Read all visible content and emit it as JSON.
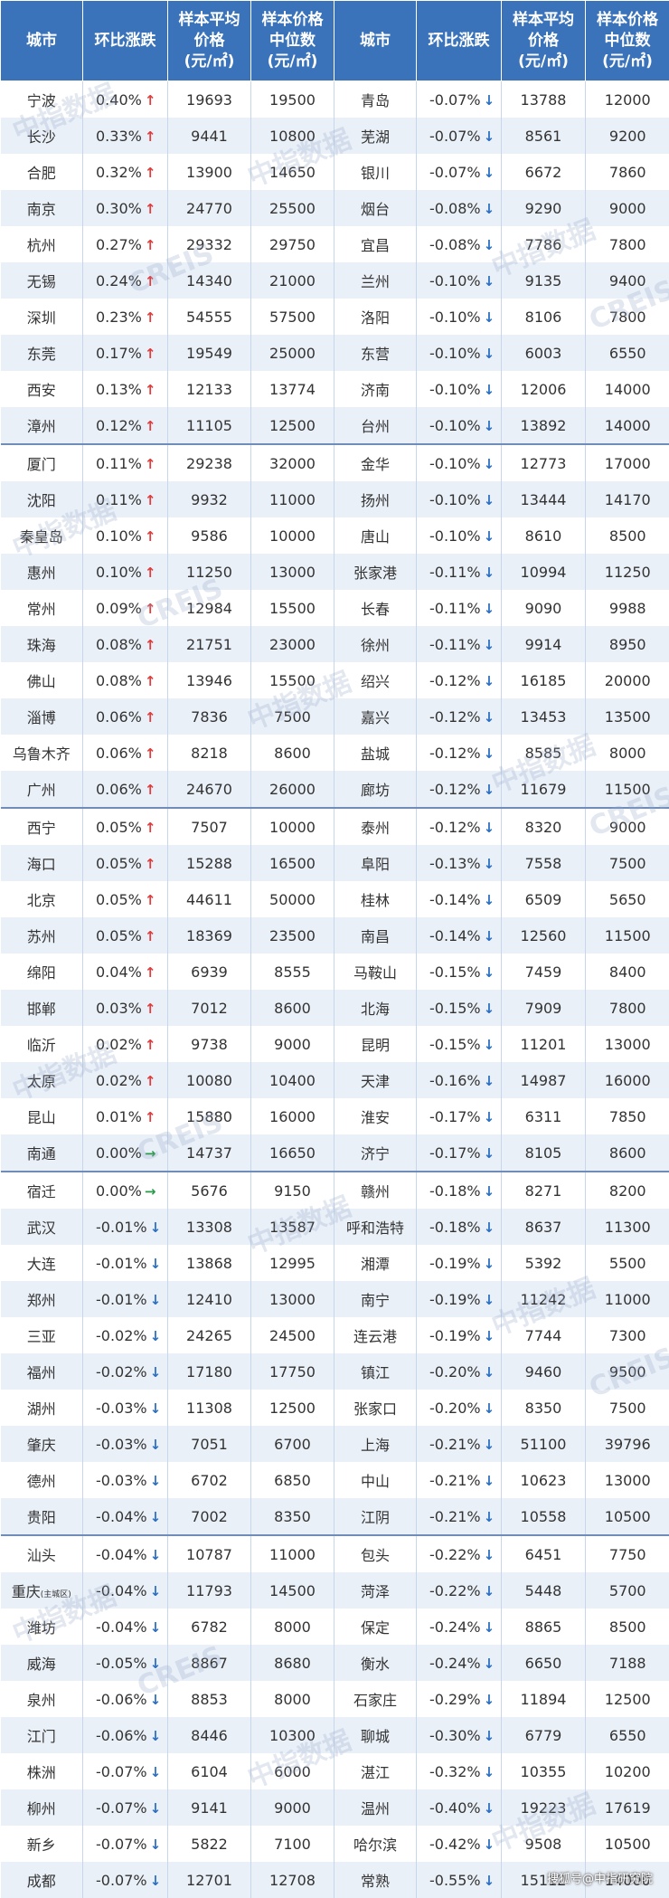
{
  "headers": {
    "city": "城市",
    "change": "环比涨跌",
    "avg_price": [
      "样本平均",
      "价格",
      "(元/㎡)"
    ],
    "median_price": [
      "样本价格",
      "中位数",
      "(元/㎡)"
    ]
  },
  "arrow_symbols": {
    "up": "↑",
    "down": "↓",
    "flat": "→"
  },
  "rows": [
    {
      "left": {
        "city": "宁波",
        "change": "0.40%",
        "dir": "up",
        "avg": "19693",
        "median": "19500"
      },
      "right": {
        "city": "青岛",
        "change": "-0.07%",
        "dir": "down",
        "avg": "13788",
        "median": "12000"
      }
    },
    {
      "left": {
        "city": "长沙",
        "change": "0.33%",
        "dir": "up",
        "avg": "9441",
        "median": "10800"
      },
      "right": {
        "city": "芜湖",
        "change": "-0.07%",
        "dir": "down",
        "avg": "8561",
        "median": "9200"
      }
    },
    {
      "left": {
        "city": "合肥",
        "change": "0.32%",
        "dir": "up",
        "avg": "13900",
        "median": "14650"
      },
      "right": {
        "city": "银川",
        "change": "-0.07%",
        "dir": "down",
        "avg": "6672",
        "median": "7860"
      }
    },
    {
      "left": {
        "city": "南京",
        "change": "0.30%",
        "dir": "up",
        "avg": "24770",
        "median": "25500"
      },
      "right": {
        "city": "烟台",
        "change": "-0.08%",
        "dir": "down",
        "avg": "9290",
        "median": "9000"
      }
    },
    {
      "left": {
        "city": "杭州",
        "change": "0.27%",
        "dir": "up",
        "avg": "29332",
        "median": "29750"
      },
      "right": {
        "city": "宜昌",
        "change": "-0.08%",
        "dir": "down",
        "avg": "7786",
        "median": "7800"
      }
    },
    {
      "left": {
        "city": "无锡",
        "change": "0.24%",
        "dir": "up",
        "avg": "14340",
        "median": "21000"
      },
      "right": {
        "city": "兰州",
        "change": "-0.10%",
        "dir": "down",
        "avg": "9135",
        "median": "9400"
      }
    },
    {
      "left": {
        "city": "深圳",
        "change": "0.23%",
        "dir": "up",
        "avg": "54555",
        "median": "57500"
      },
      "right": {
        "city": "洛阳",
        "change": "-0.10%",
        "dir": "down",
        "avg": "8106",
        "median": "7800"
      }
    },
    {
      "left": {
        "city": "东莞",
        "change": "0.17%",
        "dir": "up",
        "avg": "19549",
        "median": "25000"
      },
      "right": {
        "city": "东营",
        "change": "-0.10%",
        "dir": "down",
        "avg": "6003",
        "median": "6550"
      }
    },
    {
      "left": {
        "city": "西安",
        "change": "0.13%",
        "dir": "up",
        "avg": "12133",
        "median": "13774"
      },
      "right": {
        "city": "济南",
        "change": "-0.10%",
        "dir": "down",
        "avg": "12006",
        "median": "14000"
      }
    },
    {
      "left": {
        "city": "漳州",
        "change": "0.12%",
        "dir": "up",
        "avg": "11105",
        "median": "12500"
      },
      "right": {
        "city": "台州",
        "change": "-0.10%",
        "dir": "down",
        "avg": "13892",
        "median": "14000"
      }
    },
    {
      "left": {
        "city": "厦门",
        "change": "0.11%",
        "dir": "up",
        "avg": "29238",
        "median": "32000"
      },
      "right": {
        "city": "金华",
        "change": "-0.10%",
        "dir": "down",
        "avg": "12773",
        "median": "17000"
      }
    },
    {
      "left": {
        "city": "沈阳",
        "change": "0.11%",
        "dir": "up",
        "avg": "9932",
        "median": "11000"
      },
      "right": {
        "city": "扬州",
        "change": "-0.10%",
        "dir": "down",
        "avg": "13444",
        "median": "14170"
      }
    },
    {
      "left": {
        "city": "秦皇岛",
        "change": "0.10%",
        "dir": "up",
        "avg": "9586",
        "median": "10000"
      },
      "right": {
        "city": "唐山",
        "change": "-0.10%",
        "dir": "down",
        "avg": "8610",
        "median": "8500"
      }
    },
    {
      "left": {
        "city": "惠州",
        "change": "0.10%",
        "dir": "up",
        "avg": "11250",
        "median": "13000"
      },
      "right": {
        "city": "张家港",
        "change": "-0.11%",
        "dir": "down",
        "avg": "10994",
        "median": "11250"
      }
    },
    {
      "left": {
        "city": "常州",
        "change": "0.09%",
        "dir": "up",
        "avg": "12984",
        "median": "15500"
      },
      "right": {
        "city": "长春",
        "change": "-0.11%",
        "dir": "down",
        "avg": "9090",
        "median": "9988"
      }
    },
    {
      "left": {
        "city": "珠海",
        "change": "0.08%",
        "dir": "up",
        "avg": "21751",
        "median": "23000"
      },
      "right": {
        "city": "徐州",
        "change": "-0.11%",
        "dir": "down",
        "avg": "9914",
        "median": "8950"
      }
    },
    {
      "left": {
        "city": "佛山",
        "change": "0.08%",
        "dir": "up",
        "avg": "13946",
        "median": "15500"
      },
      "right": {
        "city": "绍兴",
        "change": "-0.12%",
        "dir": "down",
        "avg": "16185",
        "median": "20000"
      }
    },
    {
      "left": {
        "city": "淄博",
        "change": "0.06%",
        "dir": "up",
        "avg": "7836",
        "median": "7500"
      },
      "right": {
        "city": "嘉兴",
        "change": "-0.12%",
        "dir": "down",
        "avg": "13453",
        "median": "13500"
      }
    },
    {
      "left": {
        "city": "乌鲁木齐",
        "change": "0.06%",
        "dir": "up",
        "avg": "8218",
        "median": "8600"
      },
      "right": {
        "city": "盐城",
        "change": "-0.12%",
        "dir": "down",
        "avg": "8585",
        "median": "8000"
      }
    },
    {
      "left": {
        "city": "广州",
        "change": "0.06%",
        "dir": "up",
        "avg": "24670",
        "median": "26000"
      },
      "right": {
        "city": "廊坊",
        "change": "-0.12%",
        "dir": "down",
        "avg": "11679",
        "median": "11500"
      }
    },
    {
      "left": {
        "city": "西宁",
        "change": "0.05%",
        "dir": "up",
        "avg": "7507",
        "median": "10000"
      },
      "right": {
        "city": "泰州",
        "change": "-0.12%",
        "dir": "down",
        "avg": "8320",
        "median": "9000"
      }
    },
    {
      "left": {
        "city": "海口",
        "change": "0.05%",
        "dir": "up",
        "avg": "15288",
        "median": "16500"
      },
      "right": {
        "city": "阜阳",
        "change": "-0.13%",
        "dir": "down",
        "avg": "7558",
        "median": "7500"
      }
    },
    {
      "left": {
        "city": "北京",
        "change": "0.05%",
        "dir": "up",
        "avg": "44611",
        "median": "50000"
      },
      "right": {
        "city": "桂林",
        "change": "-0.14%",
        "dir": "down",
        "avg": "6509",
        "median": "5650"
      }
    },
    {
      "left": {
        "city": "苏州",
        "change": "0.05%",
        "dir": "up",
        "avg": "18369",
        "median": "23500"
      },
      "right": {
        "city": "南昌",
        "change": "-0.14%",
        "dir": "down",
        "avg": "12560",
        "median": "11500"
      }
    },
    {
      "left": {
        "city": "绵阳",
        "change": "0.04%",
        "dir": "up",
        "avg": "6939",
        "median": "8555"
      },
      "right": {
        "city": "马鞍山",
        "change": "-0.15%",
        "dir": "down",
        "avg": "7459",
        "median": "8400"
      }
    },
    {
      "left": {
        "city": "邯郸",
        "change": "0.03%",
        "dir": "up",
        "avg": "7012",
        "median": "8600"
      },
      "right": {
        "city": "北海",
        "change": "-0.15%",
        "dir": "down",
        "avg": "7909",
        "median": "7800"
      }
    },
    {
      "left": {
        "city": "临沂",
        "change": "0.02%",
        "dir": "up",
        "avg": "9738",
        "median": "9000"
      },
      "right": {
        "city": "昆明",
        "change": "-0.15%",
        "dir": "down",
        "avg": "11201",
        "median": "13000"
      }
    },
    {
      "left": {
        "city": "太原",
        "change": "0.02%",
        "dir": "up",
        "avg": "10080",
        "median": "10400"
      },
      "right": {
        "city": "天津",
        "change": "-0.16%",
        "dir": "down",
        "avg": "14987",
        "median": "16000"
      }
    },
    {
      "left": {
        "city": "昆山",
        "change": "0.01%",
        "dir": "up",
        "avg": "15880",
        "median": "16000"
      },
      "right": {
        "city": "淮安",
        "change": "-0.17%",
        "dir": "down",
        "avg": "6311",
        "median": "7850"
      }
    },
    {
      "left": {
        "city": "南通",
        "change": "0.00%",
        "dir": "flat",
        "avg": "14737",
        "median": "16650"
      },
      "right": {
        "city": "济宁",
        "change": "-0.17%",
        "dir": "down",
        "avg": "8105",
        "median": "8600"
      }
    },
    {
      "left": {
        "city": "宿迁",
        "change": "0.00%",
        "dir": "flat",
        "avg": "5676",
        "median": "9150"
      },
      "right": {
        "city": "赣州",
        "change": "-0.18%",
        "dir": "down",
        "avg": "8271",
        "median": "8200"
      }
    },
    {
      "left": {
        "city": "武汉",
        "change": "-0.01%",
        "dir": "down",
        "avg": "13308",
        "median": "13587"
      },
      "right": {
        "city": "呼和浩特",
        "change": "-0.18%",
        "dir": "down",
        "avg": "8637",
        "median": "11300"
      }
    },
    {
      "left": {
        "city": "大连",
        "change": "-0.01%",
        "dir": "down",
        "avg": "13868",
        "median": "12995"
      },
      "right": {
        "city": "湘潭",
        "change": "-0.19%",
        "dir": "down",
        "avg": "5392",
        "median": "5500"
      }
    },
    {
      "left": {
        "city": "郑州",
        "change": "-0.01%",
        "dir": "down",
        "avg": "12410",
        "median": "13000"
      },
      "right": {
        "city": "南宁",
        "change": "-0.19%",
        "dir": "down",
        "avg": "11242",
        "median": "11000"
      }
    },
    {
      "left": {
        "city": "三亚",
        "change": "-0.02%",
        "dir": "down",
        "avg": "24265",
        "median": "24500"
      },
      "right": {
        "city": "连云港",
        "change": "-0.19%",
        "dir": "down",
        "avg": "7744",
        "median": "7300"
      }
    },
    {
      "left": {
        "city": "福州",
        "change": "-0.02%",
        "dir": "down",
        "avg": "17180",
        "median": "17750"
      },
      "right": {
        "city": "镇江",
        "change": "-0.20%",
        "dir": "down",
        "avg": "9460",
        "median": "9500"
      }
    },
    {
      "left": {
        "city": "湖州",
        "change": "-0.03%",
        "dir": "down",
        "avg": "11308",
        "median": "12500"
      },
      "right": {
        "city": "张家口",
        "change": "-0.20%",
        "dir": "down",
        "avg": "8350",
        "median": "7500"
      }
    },
    {
      "left": {
        "city": "肇庆",
        "change": "-0.03%",
        "dir": "down",
        "avg": "7051",
        "median": "6700"
      },
      "right": {
        "city": "上海",
        "change": "-0.21%",
        "dir": "down",
        "avg": "51100",
        "median": "39796"
      }
    },
    {
      "left": {
        "city": "德州",
        "change": "-0.03%",
        "dir": "down",
        "avg": "6702",
        "median": "6850"
      },
      "right": {
        "city": "中山",
        "change": "-0.21%",
        "dir": "down",
        "avg": "10623",
        "median": "13000"
      }
    },
    {
      "left": {
        "city": "贵阳",
        "change": "-0.04%",
        "dir": "down",
        "avg": "7002",
        "median": "8350"
      },
      "right": {
        "city": "江阴",
        "change": "-0.21%",
        "dir": "down",
        "avg": "10558",
        "median": "10500"
      }
    },
    {
      "left": {
        "city": "汕头",
        "change": "-0.04%",
        "dir": "down",
        "avg": "10787",
        "median": "11000"
      },
      "right": {
        "city": "包头",
        "change": "-0.22%",
        "dir": "down",
        "avg": "6451",
        "median": "7750"
      }
    },
    {
      "left": {
        "city": "重庆",
        "city_sub": "(主城区)",
        "change": "-0.04%",
        "dir": "down",
        "avg": "11793",
        "median": "14500"
      },
      "right": {
        "city": "菏泽",
        "change": "-0.22%",
        "dir": "down",
        "avg": "5448",
        "median": "5700"
      }
    },
    {
      "left": {
        "city": "潍坊",
        "change": "-0.04%",
        "dir": "down",
        "avg": "6782",
        "median": "8000"
      },
      "right": {
        "city": "保定",
        "change": "-0.24%",
        "dir": "down",
        "avg": "8865",
        "median": "8500"
      }
    },
    {
      "left": {
        "city": "威海",
        "change": "-0.05%",
        "dir": "down",
        "avg": "8867",
        "median": "8680"
      },
      "right": {
        "city": "衡水",
        "change": "-0.24%",
        "dir": "down",
        "avg": "6650",
        "median": "7188"
      }
    },
    {
      "left": {
        "city": "泉州",
        "change": "-0.06%",
        "dir": "down",
        "avg": "8853",
        "median": "8000"
      },
      "right": {
        "city": "石家庄",
        "change": "-0.29%",
        "dir": "down",
        "avg": "11894",
        "median": "12500"
      }
    },
    {
      "left": {
        "city": "江门",
        "change": "-0.06%",
        "dir": "down",
        "avg": "8446",
        "median": "10300"
      },
      "right": {
        "city": "聊城",
        "change": "-0.30%",
        "dir": "down",
        "avg": "6779",
        "median": "6550"
      }
    },
    {
      "left": {
        "city": "株洲",
        "change": "-0.07%",
        "dir": "down",
        "avg": "6104",
        "median": "6000"
      },
      "right": {
        "city": "湛江",
        "change": "-0.32%",
        "dir": "down",
        "avg": "10355",
        "median": "10200"
      }
    },
    {
      "left": {
        "city": "柳州",
        "change": "-0.07%",
        "dir": "down",
        "avg": "9141",
        "median": "9000"
      },
      "right": {
        "city": "温州",
        "change": "-0.40%",
        "dir": "down",
        "avg": "19223",
        "median": "17619"
      }
    },
    {
      "left": {
        "city": "新乡",
        "change": "-0.07%",
        "dir": "down",
        "avg": "5822",
        "median": "7100"
      },
      "right": {
        "city": "哈尔滨",
        "change": "-0.42%",
        "dir": "down",
        "avg": "9508",
        "median": "10500"
      }
    },
    {
      "left": {
        "city": "成都",
        "change": "-0.07%",
        "dir": "down",
        "avg": "12701",
        "median": "12708"
      },
      "right": {
        "city": "常熟",
        "change": "-0.55%",
        "dir": "down",
        "avg": "15112",
        "median": "14000"
      }
    }
  ],
  "watermark": {
    "cn": "中指数据",
    "en": "CREIS"
  },
  "credit": "搜狐号@中指研究院",
  "colors": {
    "header_bg": "#3a73b9",
    "stripe": "#eaf0f8",
    "up": "#e23b3b",
    "down": "#2b6fc4",
    "flat": "#2a9a4a"
  }
}
